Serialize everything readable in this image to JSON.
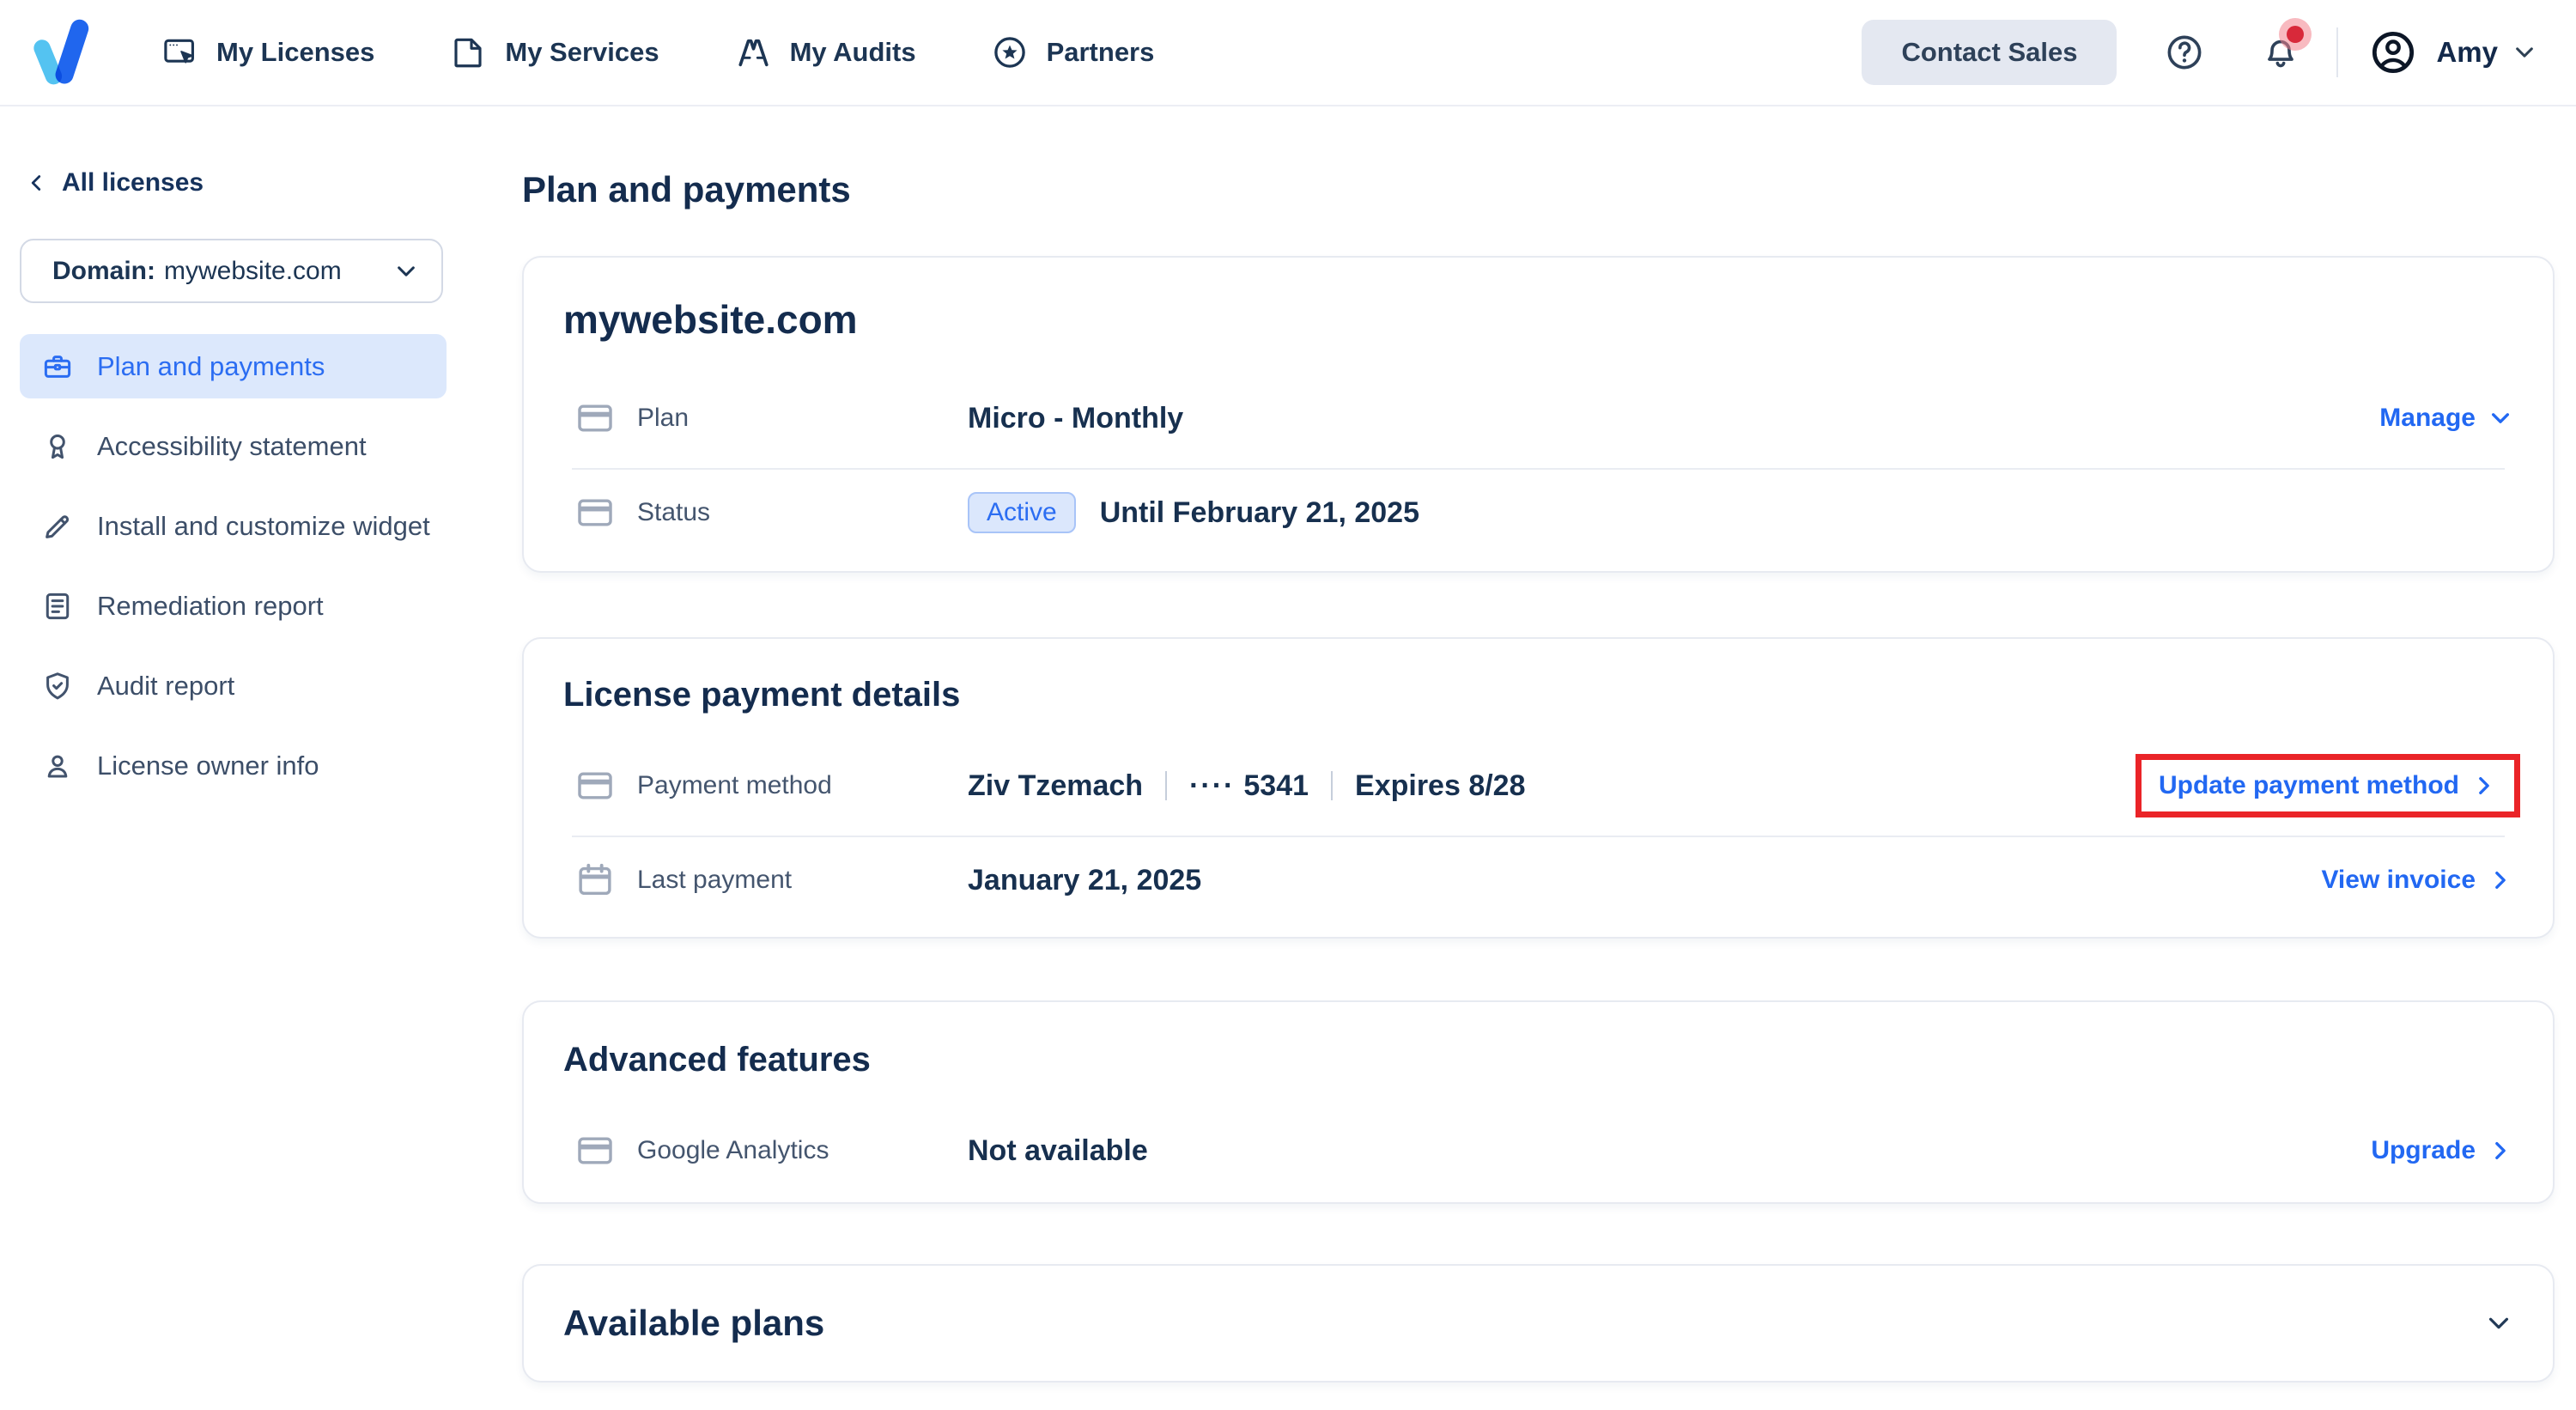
{
  "colors": {
    "accent_blue": "#2268f2",
    "navy_text": "#142c4e",
    "label_gray": "#44556e",
    "active_item_bg": "#dce8fc",
    "badge_bg": "#dbe7fc",
    "badge_border": "#a8c4f8",
    "annotation_red": "#ea2428",
    "contact_button_bg": "#e4e8f1",
    "notification_dot": "#d8293a"
  },
  "nav": {
    "logo_icon": "brand-logo",
    "items": [
      {
        "label": "My Licenses",
        "icon": "licenses-icon"
      },
      {
        "label": "My Services",
        "icon": "services-icon"
      },
      {
        "label": "My Audits",
        "icon": "audits-icon"
      },
      {
        "label": "Partners",
        "icon": "partners-icon"
      }
    ],
    "contact_sales_label": "Contact Sales",
    "help_icon": "question-icon",
    "notifications_icon": "bell-icon",
    "has_unread_notification": true,
    "user_name": "Amy"
  },
  "sidebar": {
    "back_label": "All licenses",
    "domain_label": "Domain:",
    "domain_value": "mywebsite.com",
    "items": [
      {
        "label": "Plan and payments",
        "icon": "briefcase-icon",
        "active": true
      },
      {
        "label": "Accessibility statement",
        "icon": "award-icon",
        "active": false
      },
      {
        "label": "Install and customize widget",
        "icon": "pencil-icon",
        "active": false
      },
      {
        "label": "Remediation report",
        "icon": "report-icon",
        "active": false
      },
      {
        "label": "Audit report",
        "icon": "shield-check-icon",
        "active": false
      },
      {
        "label": "License owner info",
        "icon": "person-icon",
        "active": false
      }
    ]
  },
  "page": {
    "title": "Plan and payments",
    "license_card": {
      "title": "mywebsite.com",
      "plan_row": {
        "icon": "credit-card-icon",
        "label": "Plan",
        "value": "Micro - Monthly",
        "action_label": "Manage"
      },
      "status_row": {
        "icon": "credit-card-icon",
        "label": "Status",
        "badge": "Active",
        "value": "Until February 21, 2025"
      }
    },
    "payment_card": {
      "title": "License payment details",
      "payment_method_row": {
        "icon": "credit-card-icon",
        "label": "Payment method",
        "name": "Ziv Tzemach",
        "card_mask": "····",
        "card_last4": "5341",
        "expires": "Expires 8/28",
        "action_label": "Update payment method",
        "highlighted_with_red_box": true
      },
      "last_payment_row": {
        "icon": "calendar-icon",
        "label": "Last payment",
        "value": "January 21, 2025",
        "action_label": "View invoice"
      }
    },
    "features_card": {
      "title": "Advanced features",
      "analytics_row": {
        "icon": "credit-card-icon",
        "label": "Google Analytics",
        "value": "Not available",
        "action_label": "Upgrade"
      }
    },
    "plans_card": {
      "title": "Available plans"
    }
  }
}
